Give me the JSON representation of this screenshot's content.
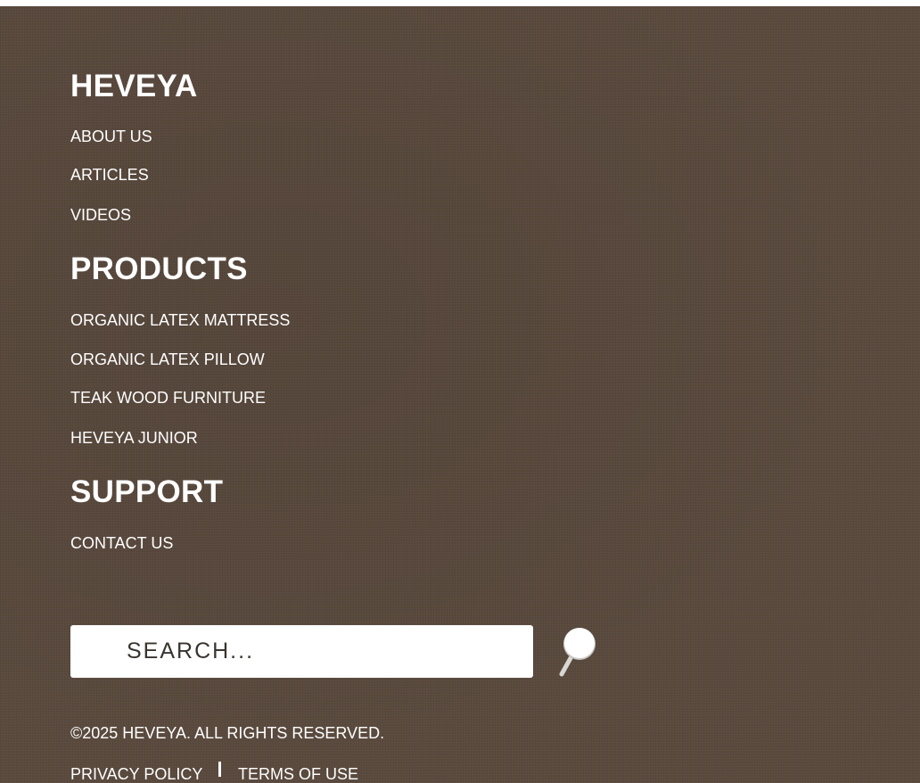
{
  "sections": {
    "heveya": {
      "title": "HEVEYA",
      "links": [
        "ABOUT US",
        "ARTICLES",
        "VIDEOS"
      ]
    },
    "products": {
      "title": "PRODUCTS",
      "links": [
        "ORGANIC LATEX MATTRESS",
        "ORGANIC LATEX PILLOW",
        "TEAK WOOD FURNITURE",
        "HEVEYA JUNIOR"
      ]
    },
    "support": {
      "title": "SUPPORT",
      "links": [
        "CONTACT US"
      ]
    }
  },
  "search": {
    "placeholder": "SEARCH...",
    "value": "",
    "button_icon": "magnifier-icon"
  },
  "copyright": "©2025 HEVEYA. ALL RIGHTS RESERVED.",
  "legal": {
    "privacy": "PRIVACY POLICY",
    "terms": "TERMS OF USE"
  },
  "colors": {
    "background": "#5a4a3e",
    "text": "#ffffff",
    "search_text": "#3a342e"
  }
}
